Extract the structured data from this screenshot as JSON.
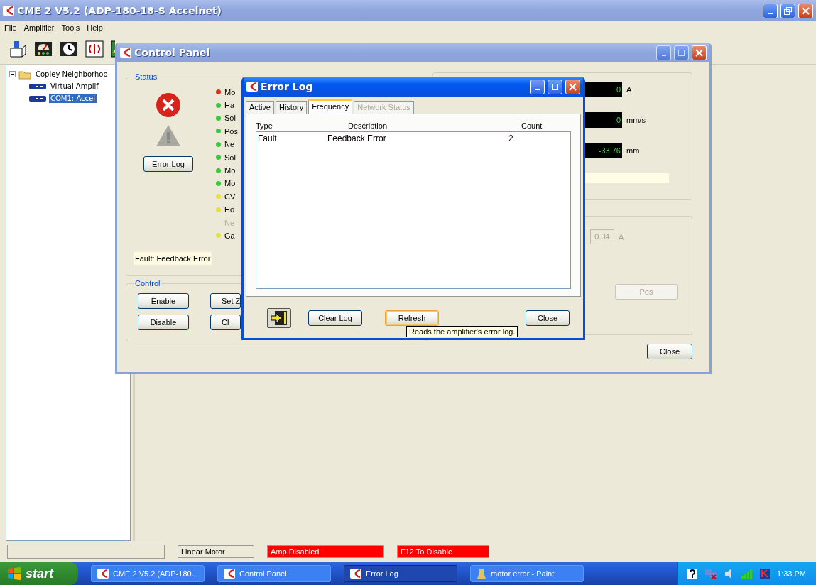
{
  "main_window": {
    "title": "CME 2 V5.2 (ADP-180-18-S Accelnet)",
    "menu": [
      "File",
      "Amplifier",
      "Tools",
      "Help"
    ],
    "tree": {
      "label": "Copley Neighborhoo",
      "expanded": true,
      "children": [
        {
          "label": "Virtual Amplif",
          "selected": false
        },
        {
          "label": "COM1: Accel",
          "selected": true
        }
      ]
    },
    "status_bar": [
      {
        "text": "Linear Motor",
        "color": "#ece9d8"
      },
      {
        "text": "Amp Disabled",
        "color": "#ff0000"
      },
      {
        "text": "F12 To Disable",
        "color": "#ff0000"
      }
    ]
  },
  "control_panel": {
    "title": "Control Panel",
    "status": {
      "title": "Status",
      "error_log_button": "Error Log",
      "fault_text": "Fault:  Feedback Error",
      "indicators": [
        {
          "label": "Mo",
          "color": "#d8321c",
          "disabled": false
        },
        {
          "label": "Ha",
          "color": "#3cc83c",
          "disabled": false
        },
        {
          "label": "Sol",
          "color": "#3cc83c",
          "disabled": false
        },
        {
          "label": "Pos",
          "color": "#3cc83c",
          "disabled": false
        },
        {
          "label": "Ne",
          "color": "#3cc83c",
          "disabled": false
        },
        {
          "label": "Sol",
          "color": "#3cc83c",
          "disabled": false
        },
        {
          "label": "Mo",
          "color": "#3cc83c",
          "disabled": false
        },
        {
          "label": "Mo",
          "color": "#3cc83c",
          "disabled": false
        },
        {
          "label": "CV",
          "color": "#e8e040",
          "disabled": false
        },
        {
          "label": "Ho",
          "color": "#e8e040",
          "disabled": false
        },
        {
          "label": "Ne",
          "disabled": true
        },
        {
          "label": "Ga",
          "color": "#e8e040",
          "disabled": false
        }
      ]
    },
    "control": {
      "title": "Control",
      "buttons": [
        "Enable",
        "Set Z",
        "Disable",
        "Cl"
      ]
    },
    "readings": [
      {
        "value": "0",
        "unit": "A"
      },
      {
        "value": "0",
        "unit": "mm/s"
      },
      {
        "value": "-33.76",
        "unit": "mm"
      }
    ],
    "setpoint": {
      "value": "0.34",
      "unit": "A",
      "disabled": true
    },
    "pos_button": {
      "label": "Pos",
      "disabled": true
    },
    "close_button": "Close"
  },
  "error_log": {
    "title": "Error Log",
    "tabs": [
      {
        "label": "Active",
        "selected": false,
        "disabled": false
      },
      {
        "label": "History",
        "selected": false,
        "disabled": false
      },
      {
        "label": "Frequency",
        "selected": true,
        "disabled": false
      },
      {
        "label": "Network Status",
        "selected": false,
        "disabled": true
      }
    ],
    "columns": [
      "Type",
      "Description",
      "Count"
    ],
    "rows": [
      [
        "Fault",
        "Feedback Error",
        "2"
      ]
    ],
    "clear_button": "Clear Log",
    "refresh_button": "Refresh",
    "close_button": "Close",
    "tooltip": "Reads the amplifier's error log."
  },
  "taskbar": {
    "start": "start",
    "tasks": [
      {
        "label": "CME 2 V5.2 (ADP-180...",
        "selected": false
      },
      {
        "label": "Control Panel",
        "selected": false
      },
      {
        "label": "Error Log",
        "selected": true
      },
      {
        "label": "motor error - Paint",
        "selected": false
      }
    ],
    "clock": "1:33 PM"
  }
}
